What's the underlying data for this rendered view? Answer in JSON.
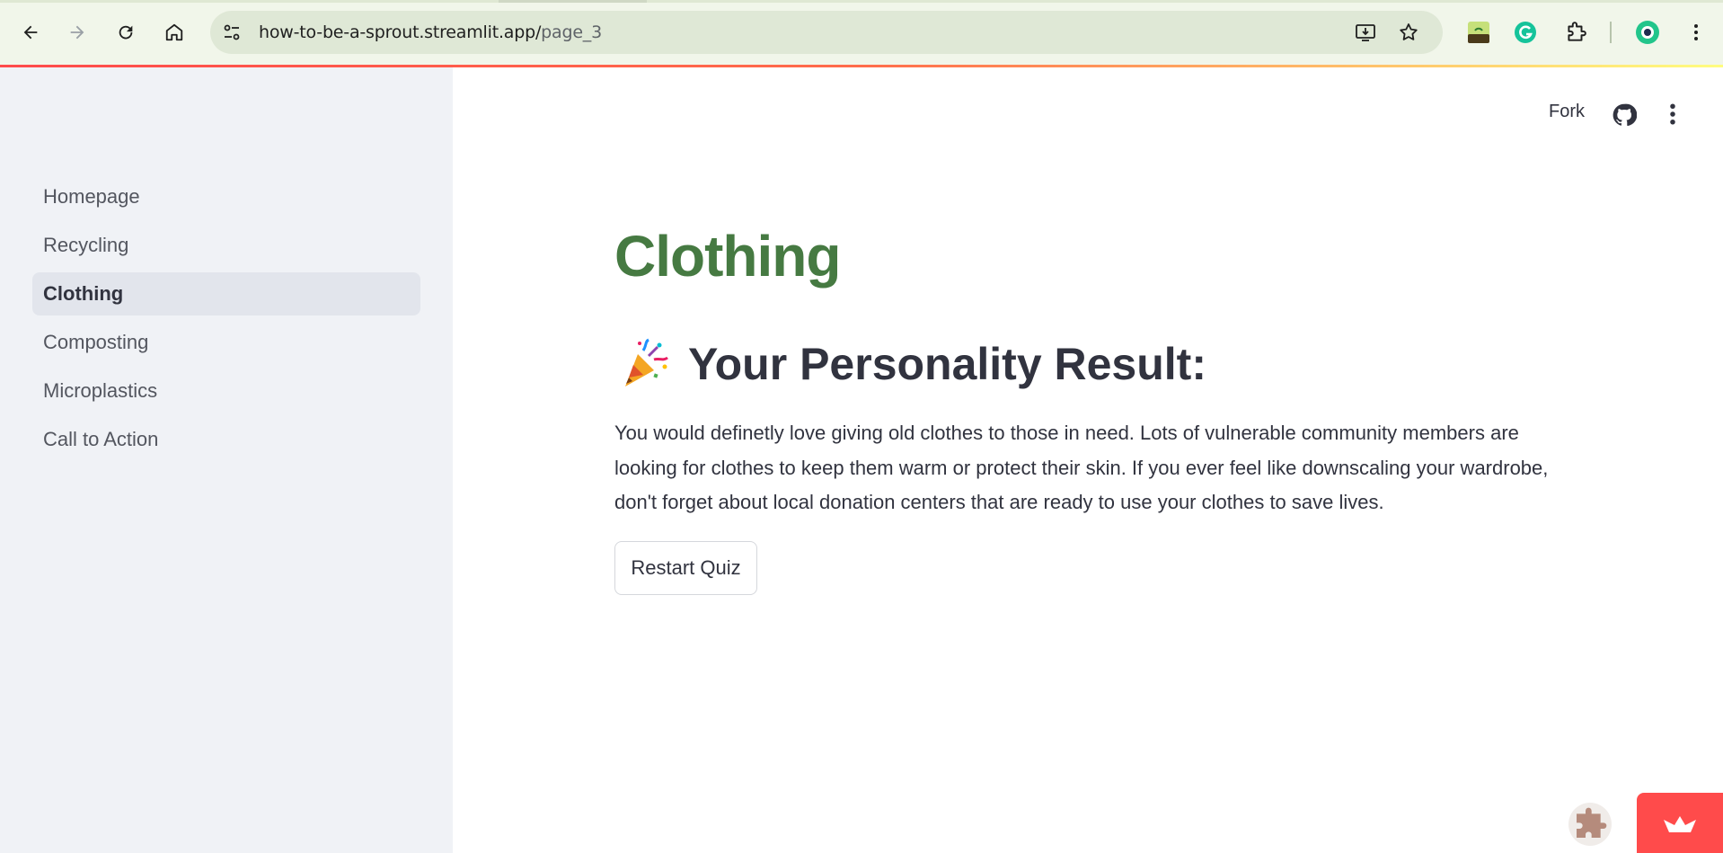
{
  "browser": {
    "url_host": "how-to-be-a-sprout.streamlit.app/",
    "url_path": "page_3",
    "icons": [
      "back-icon",
      "forward-icon",
      "reload-icon",
      "home-icon",
      "site-info-icon",
      "install-app-icon",
      "bookmark-star-icon",
      "extension-sprout-icon",
      "grammarly-icon",
      "extensions-puzzle-icon",
      "profile-avatar-icon",
      "chrome-menu-icon"
    ]
  },
  "sidebar": {
    "items": [
      {
        "label": "Homepage",
        "active": false
      },
      {
        "label": "Recycling",
        "active": false
      },
      {
        "label": "Clothing",
        "active": true
      },
      {
        "label": "Composting",
        "active": false
      },
      {
        "label": "Microplastics",
        "active": false
      },
      {
        "label": "Call to Action",
        "active": false
      }
    ]
  },
  "header": {
    "fork_label": "Fork"
  },
  "main": {
    "title": "Clothing",
    "subtitle": "Your Personality Result:",
    "body": "You would definetly love giving old clothes to those in need. Lots of vulnerable community members are looking for clothes to keep them warm or protect their skin. If you ever feel like downscaling your wardrobe, don't forget about local donation centers that are ready to use your clothes to save lives.",
    "restart_label": "Restart Quiz"
  },
  "colors": {
    "title_green": "#467a42",
    "accent_red": "#ff4b4b",
    "sidebar_bg": "#f0f2f6"
  }
}
